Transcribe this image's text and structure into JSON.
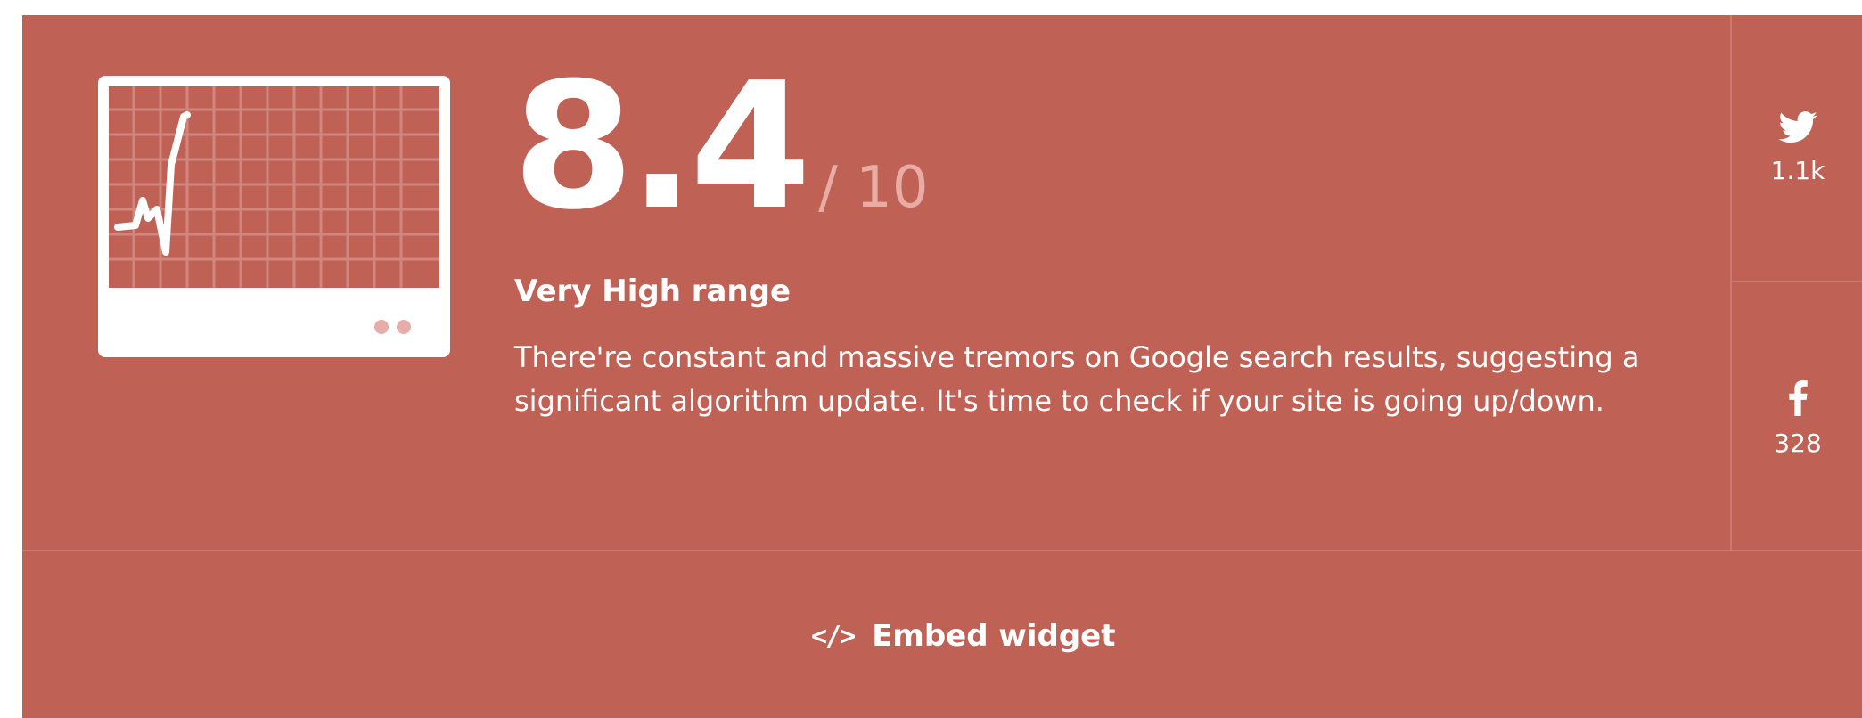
{
  "score": {
    "value": "8.4",
    "max": "/ 10",
    "range_label": "Very High range",
    "description": "There're constant and massive tremors on Google search results, suggesting a significant algorithm update. It's time to check if your site is going up/down."
  },
  "share": {
    "twitter": {
      "icon": "twitter-icon",
      "count": "1.1k"
    },
    "facebook": {
      "icon": "facebook-icon",
      "count": "328"
    }
  },
  "footer": {
    "embed_icon": "</>",
    "embed_label": "Embed widget"
  },
  "colors": {
    "background": "#c06155",
    "text": "#ffffff",
    "muted": "#e9aca5",
    "divider": "#cc7a70"
  }
}
